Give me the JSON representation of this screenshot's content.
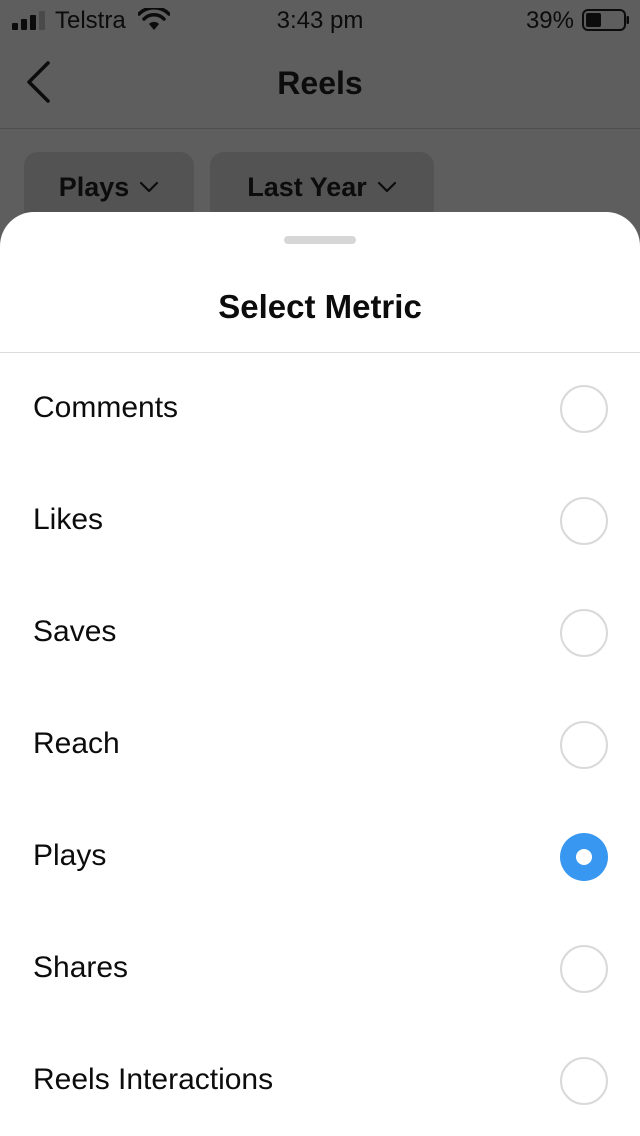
{
  "status_bar": {
    "carrier": "Telstra",
    "time": "3:43 pm",
    "battery_percent": "39%"
  },
  "nav": {
    "title": "Reels"
  },
  "filters": {
    "metric": "Plays",
    "period": "Last Year"
  },
  "sheet": {
    "title": "Select Metric",
    "options": [
      {
        "label": "Comments",
        "selected": false
      },
      {
        "label": "Likes",
        "selected": false
      },
      {
        "label": "Saves",
        "selected": false
      },
      {
        "label": "Reach",
        "selected": false
      },
      {
        "label": "Plays",
        "selected": true
      },
      {
        "label": "Shares",
        "selected": false
      },
      {
        "label": "Reels Interactions",
        "selected": false
      }
    ]
  },
  "colors": {
    "accent": "#3897f0",
    "overlay": "#5e5e5e"
  }
}
